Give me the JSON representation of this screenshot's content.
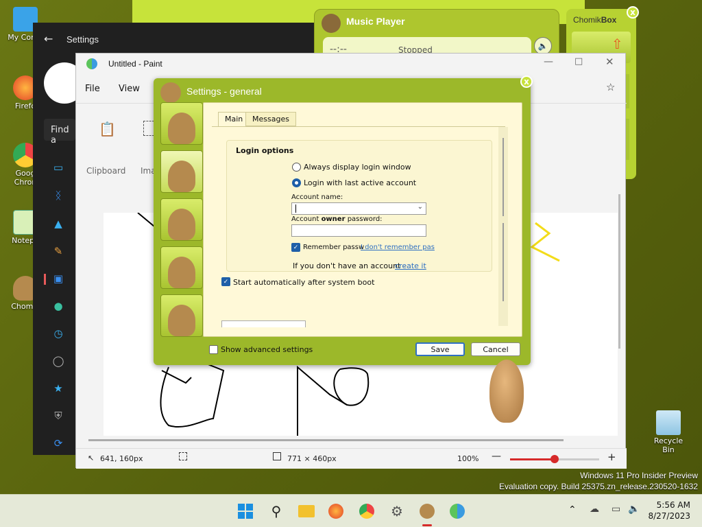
{
  "desktop": {
    "icons": [
      {
        "label": "My Comp"
      },
      {
        "label": "Firefo"
      },
      {
        "label": "Goog Chron"
      },
      {
        "label": "Notepa"
      },
      {
        "label": "Chomik"
      }
    ],
    "recycle_bin": "Recycle Bin",
    "watermark_line1": "Windows 11 Pro Insider Preview",
    "watermark_line2": "Evaluation copy. Build 25375.zn_release.230520-1632"
  },
  "settings_window": {
    "title": "Settings",
    "find_placeholder": "Find a",
    "back_icon": "arrow-left-icon"
  },
  "music_player": {
    "title": "Music Player",
    "time": "--:--",
    "status": "Stopped",
    "icon": "speaker-icon"
  },
  "chomikbox": {
    "title_a": "Chomik",
    "title_b": "Box"
  },
  "paint": {
    "title": "Untitled - Paint",
    "menu": [
      "File",
      "View"
    ],
    "toolbar": {
      "clipboard": "Clipboard",
      "image": "Ima"
    },
    "status": {
      "cursor_pos": "641, 160px",
      "canvas_size": "771 × 460px",
      "zoom": "100%",
      "zoom_level": 0.5
    }
  },
  "dialog": {
    "title": "Settings - general",
    "tabs": [
      "Main",
      "Messages"
    ],
    "active_tab": "Main",
    "login_group": "Login options",
    "radio_always": "Always display login window",
    "radio_last": "Login with last active account",
    "account_name_label": "Account name:",
    "account_name_value": "",
    "password_label_a": "Account ",
    "password_label_b": "owner",
    "password_label_c": " password:",
    "remember": "Remember passw",
    "forgot_link": "I don't remember pas",
    "no_account_text": "If you don't have an account - ",
    "create_link": "create it",
    "autostart": "Start automatically after system boot",
    "show_advanced": "Show advanced settings",
    "save": "Save",
    "cancel": "Cancel",
    "close": "x"
  },
  "taskbar": {
    "time": "5:56 AM",
    "date": "8/27/2023"
  },
  "colors": {
    "accent_green": "#9cb82a",
    "link_blue": "#2e6fc2",
    "zoom_red": "#d62a2a"
  }
}
